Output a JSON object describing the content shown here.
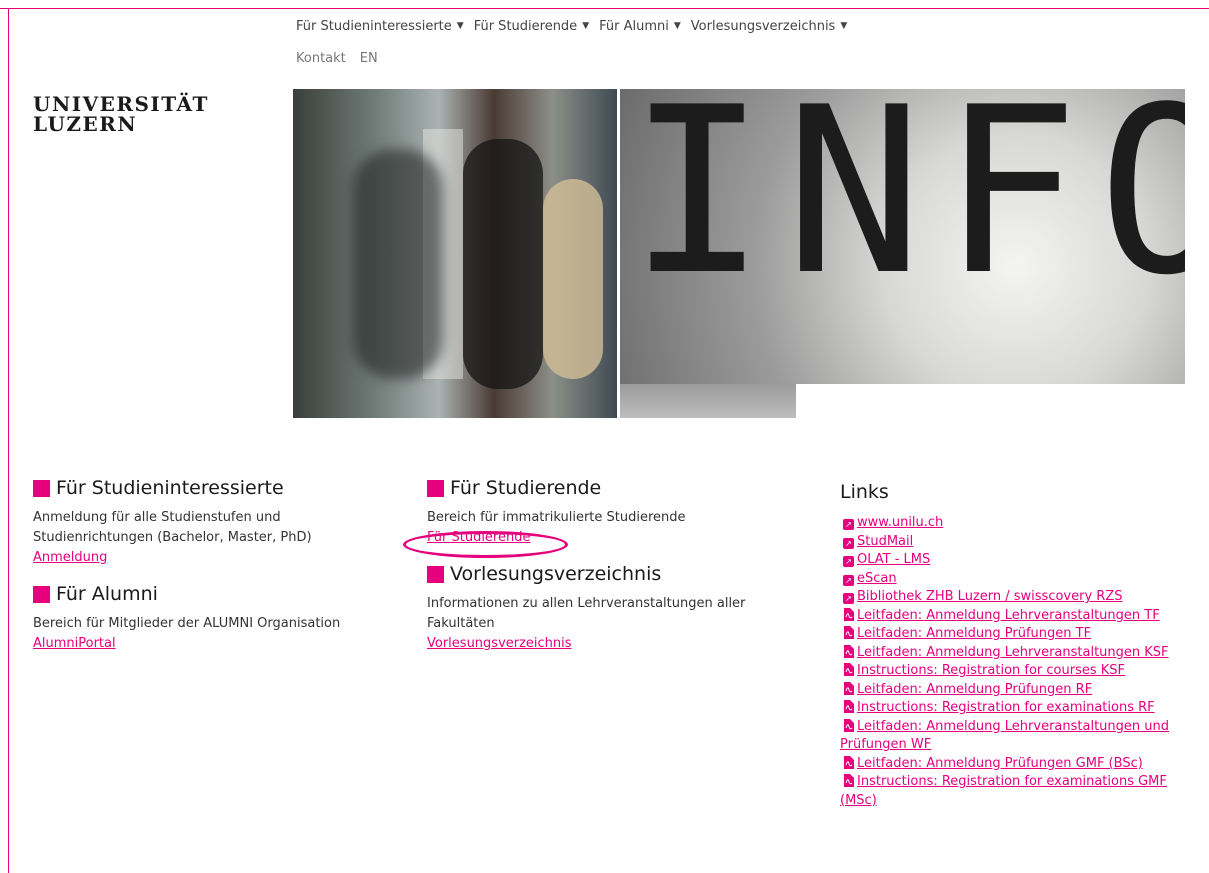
{
  "nav": {
    "items": [
      {
        "label": "Für Studieninteressierte"
      },
      {
        "label": "Für Studierende"
      },
      {
        "label": "Für Alumni"
      },
      {
        "label": "Vorlesungsverzeichnis"
      }
    ],
    "secondary": [
      {
        "label": "Kontakt"
      },
      {
        "label": "EN"
      }
    ]
  },
  "logo": {
    "line1": "UNIVERSITÄT",
    "line2": "LUZERN"
  },
  "hero": {
    "letters": "INFO"
  },
  "sections": {
    "interessierte": {
      "title": "Für Studieninteressierte",
      "text": "Anmeldung für alle Studienstufen und Studienrichtungen (Bachelor, Master, PhD)",
      "link": "Anmeldung"
    },
    "alumni": {
      "title": "Für Alumni",
      "text": "Bereich für Mitglieder der ALUMNI Organisation",
      "link": "AlumniPortal"
    },
    "studierende": {
      "title": "Für Studierende",
      "text": "Bereich für immatrikulierte Studierende",
      "link": "Für Studierende"
    },
    "vorlesungen": {
      "title": "Vorlesungsverzeichnis",
      "text": "Informationen zu allen Lehrveranstaltungen aller Fakultäten",
      "link": "Vorlesungsverzeichnis"
    }
  },
  "links": {
    "title": "Links",
    "items": [
      {
        "type": "external",
        "label": "www.unilu.ch"
      },
      {
        "type": "external",
        "label": "StudMail"
      },
      {
        "type": "external",
        "label": "OLAT - LMS"
      },
      {
        "type": "external",
        "label": "eScan"
      },
      {
        "type": "external",
        "label": "Bibliothek ZHB Luzern / swisscovery RZS"
      },
      {
        "type": "pdf",
        "label": "Leitfaden: Anmeldung Lehrveranstaltungen TF"
      },
      {
        "type": "pdf",
        "label": "Leitfaden: Anmeldung Prüfungen TF"
      },
      {
        "type": "pdf",
        "label": "Leitfaden: Anmeldung Lehrveranstaltungen KSF"
      },
      {
        "type": "pdf",
        "label": "Instructions: Registration for courses KSF"
      },
      {
        "type": "pdf",
        "label": "Leitfaden: Anmeldung Prüfungen RF"
      },
      {
        "type": "pdf",
        "label": "Instructions: Registration for examinations RF"
      },
      {
        "type": "pdf",
        "label": "Leitfaden: Anmeldung Lehrveranstaltungen und Prüfungen WF"
      },
      {
        "type": "pdf",
        "label": "Leitfaden: Anmeldung Prüfungen GMF (BSc)"
      },
      {
        "type": "pdf",
        "label": "Instructions: Registration for examinations GMF (MSc)"
      }
    ]
  },
  "colors": {
    "accent": "#e6007e"
  },
  "icons": {
    "dropdown": "caret-down-icon",
    "external": "external-link-icon",
    "pdf": "pdf-icon",
    "bullet": "square-bullet-icon"
  }
}
